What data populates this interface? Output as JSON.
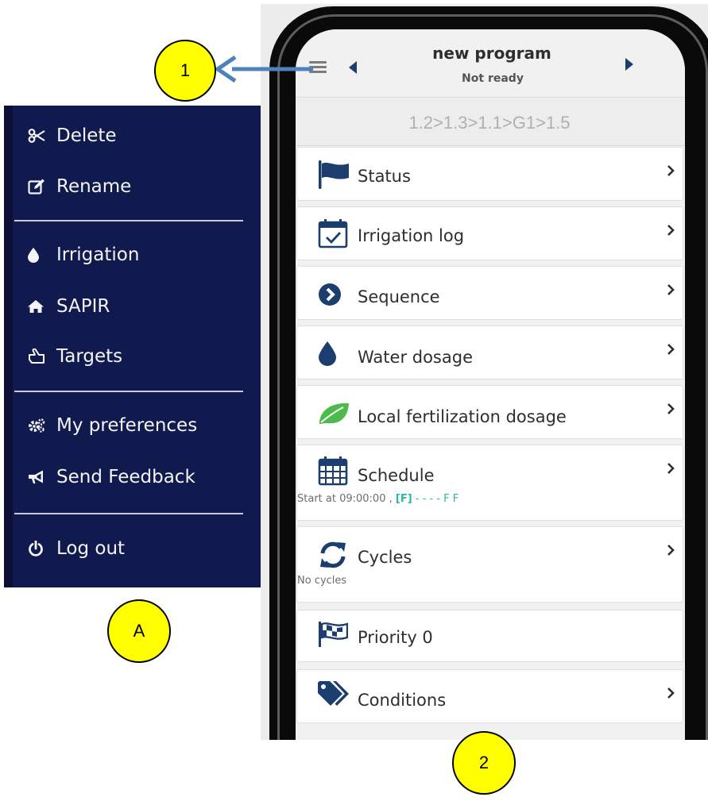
{
  "callouts": {
    "one": "1",
    "a": "A",
    "two": "2"
  },
  "side_menu": {
    "items_top": [
      {
        "label": "Delete",
        "icon": "scissors-icon"
      },
      {
        "label": "Rename",
        "icon": "edit-icon"
      }
    ],
    "items_mid": [
      {
        "label": "Irrigation",
        "icon": "drop-icon"
      },
      {
        "label": "SAPIR",
        "icon": "home-icon"
      },
      {
        "label": "Targets",
        "icon": "hand-point-icon"
      }
    ],
    "items_prefs": [
      {
        "label": "My preferences",
        "icon": "gears-icon"
      },
      {
        "label": "Send Feedback",
        "icon": "megaphone-icon"
      }
    ],
    "logout": {
      "label": "Log out",
      "icon": "power-icon"
    },
    "colors": {
      "background": "#111a4e",
      "text": "#f4f4f4"
    }
  },
  "program": {
    "title": "new program",
    "status": "Not ready",
    "sequence": "1.2>1.3>1.1>G1>1.5"
  },
  "items": [
    {
      "label": "Status",
      "icon": "flag-icon"
    },
    {
      "label": "Irrigation log",
      "icon": "calendar-check-icon"
    },
    {
      "label": "Sequence",
      "icon": "chevron-circle-icon"
    },
    {
      "label": "Water dosage",
      "icon": "water-drop-icon"
    },
    {
      "label": "Local fertilization dosage",
      "icon": "leaf-icon"
    },
    {
      "label": "Schedule",
      "icon": "calendar-icon",
      "sub_prefix": "Start at 09:00:00 ,",
      "sub_bracket": "[F]",
      "sub_dashes": "- - - -",
      "sub_days": "F F"
    },
    {
      "label": "Cycles",
      "icon": "refresh-icon",
      "sub": "No cycles"
    },
    {
      "label": "Priority 0",
      "icon": "checkered-flag-icon"
    },
    {
      "label": "Conditions",
      "icon": "tags-icon"
    }
  ],
  "colors": {
    "accent_teal": "#27b9a6",
    "icon_navy": "#1c3e6e",
    "leaf_green": "#4cbb4c"
  }
}
